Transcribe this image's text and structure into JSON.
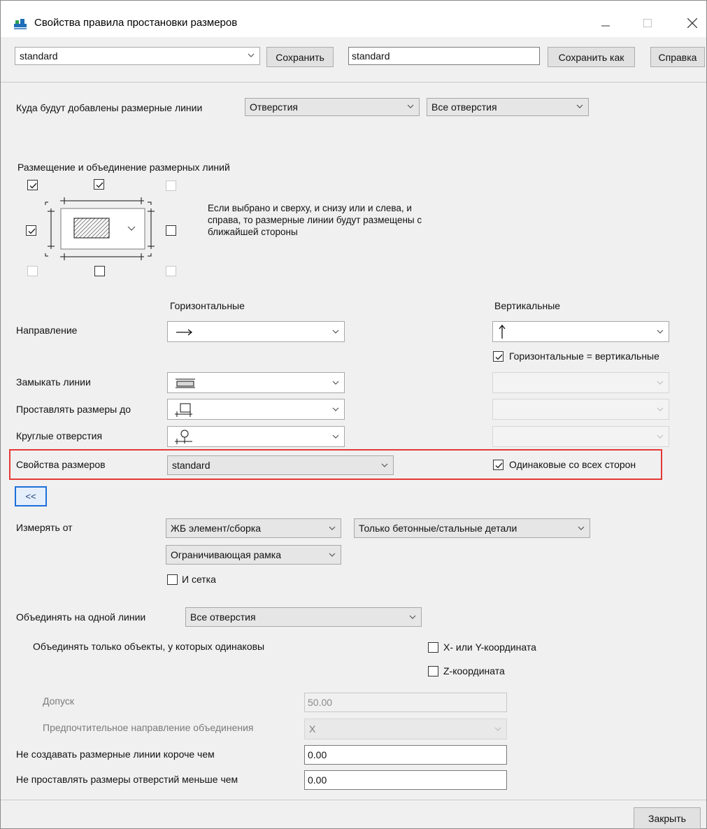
{
  "window": {
    "title": "Свойства правила простановки размеров",
    "minimize_icon": "minimize-icon",
    "maximize_icon": "maximize-icon",
    "close_icon": "close-icon"
  },
  "toolbar": {
    "preset_select_value": "standard",
    "save_label": "Сохранить",
    "name_input_value": "standard",
    "save_as_label": "Сохранить как",
    "help_label": "Справка"
  },
  "target": {
    "label": "Куда будут добавлены размерные линии",
    "type_value": "Отверстия",
    "filter_value": "Все отверстия"
  },
  "placement": {
    "label": "Размещение и объединение размерных линий",
    "hint": "Если выбрано и сверху, и снизу или и слева, и справа, то размерные линии будут размещены с ближайшей стороны",
    "checkboxes": {
      "top_left": true,
      "top": true,
      "top_right": false,
      "left": true,
      "right": false,
      "bottom_left": false,
      "bottom": false,
      "bottom_right": false
    }
  },
  "directions": {
    "horizontal_header": "Горизонтальные",
    "vertical_header": "Вертикальные",
    "direction_label": "Направление",
    "same_hv_label": "Горизонтальные = вертикальные",
    "same_hv_checked": true
  },
  "lines": {
    "close_lines_label": "Замыкать линии",
    "dimension_to_label": "Проставлять размеры до",
    "round_holes_label": "Круглые отверстия"
  },
  "dimension_props": {
    "label": "Свойства размеров",
    "value": "standard",
    "same_all_sides_label": "Одинаковые со всех сторон",
    "same_all_sides_checked": true
  },
  "collapse_button": "<<",
  "measure": {
    "label": "Измерять от",
    "from_value": "ЖБ элемент/сборка",
    "parts_value": "Только бетонные/стальные детали",
    "frame_value": "Ограничивающая рамка",
    "grid_label": "И сетка",
    "grid_checked": false
  },
  "merge": {
    "label": "Объединять на одной линии",
    "value": "Все отверстия",
    "only_objects_label": "Объединять только объекты, у которых одинаковы",
    "xy_label": "X- или Y-координата",
    "xy_checked": false,
    "z_label": "Z-координата",
    "z_checked": false,
    "tolerance_label": "Допуск",
    "tolerance_value": "50.00",
    "preferred_dir_label": "Предпочтительное направление объединения",
    "preferred_dir_value": "X"
  },
  "limits": {
    "min_length_label": "Не создавать размерные линии короче чем",
    "min_length_value": "0.00",
    "min_hole_label": "Не проставлять размеры отверстий меньше чем",
    "min_hole_value": "0.00"
  },
  "close_button": "Закрыть"
}
